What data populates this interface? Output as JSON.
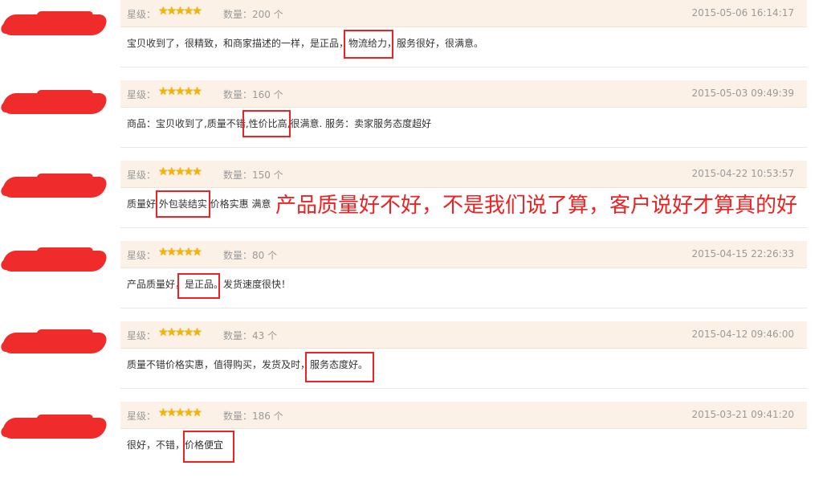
{
  "labels": {
    "rating": "星级：",
    "quantity": "数量："
  },
  "stars": "★★★★★",
  "reviews": [
    {
      "qty": "200 个",
      "date": "2015-05-06 16:14:17",
      "text": "宝贝收到了，很精致，和商家描述的一样，是正品，物流给力，服务很好，很满意。",
      "highlight": "物流给力"
    },
    {
      "qty": "160 个",
      "date": "2015-05-03 09:49:39",
      "text": "商品：宝贝收到了,质量不错,性价比高,很满意. 服务：卖家服务态度超好",
      "highlight": "性价比高"
    },
    {
      "qty": "150 个",
      "date": "2015-04-22 10:53:57",
      "text": "质量好 外包装结实 价格实惠 满意",
      "highlight": "外包装结实"
    },
    {
      "qty": "80 个",
      "date": "2015-04-15 22:26:33",
      "text": "产品质量好，是正品。发货速度很快！",
      "highlight": "是正品"
    },
    {
      "qty": "43 个",
      "date": "2015-04-12 09:46:00",
      "text": "质量不错价格实惠，值得购买，发货及时，服务态度好。",
      "highlight": "服务态度好"
    },
    {
      "qty": "186 个",
      "date": "2015-03-21 09:41:20",
      "text": "很好，不错，价格便宜",
      "highlight": "价格便宜"
    }
  ],
  "overlay_text": "产品质量好不好，不是我们说了算，客户说好才算真的好",
  "colors": {
    "header_bg": "#fbf1e6",
    "highlight": "#ee2222",
    "star": "#f5b400"
  }
}
